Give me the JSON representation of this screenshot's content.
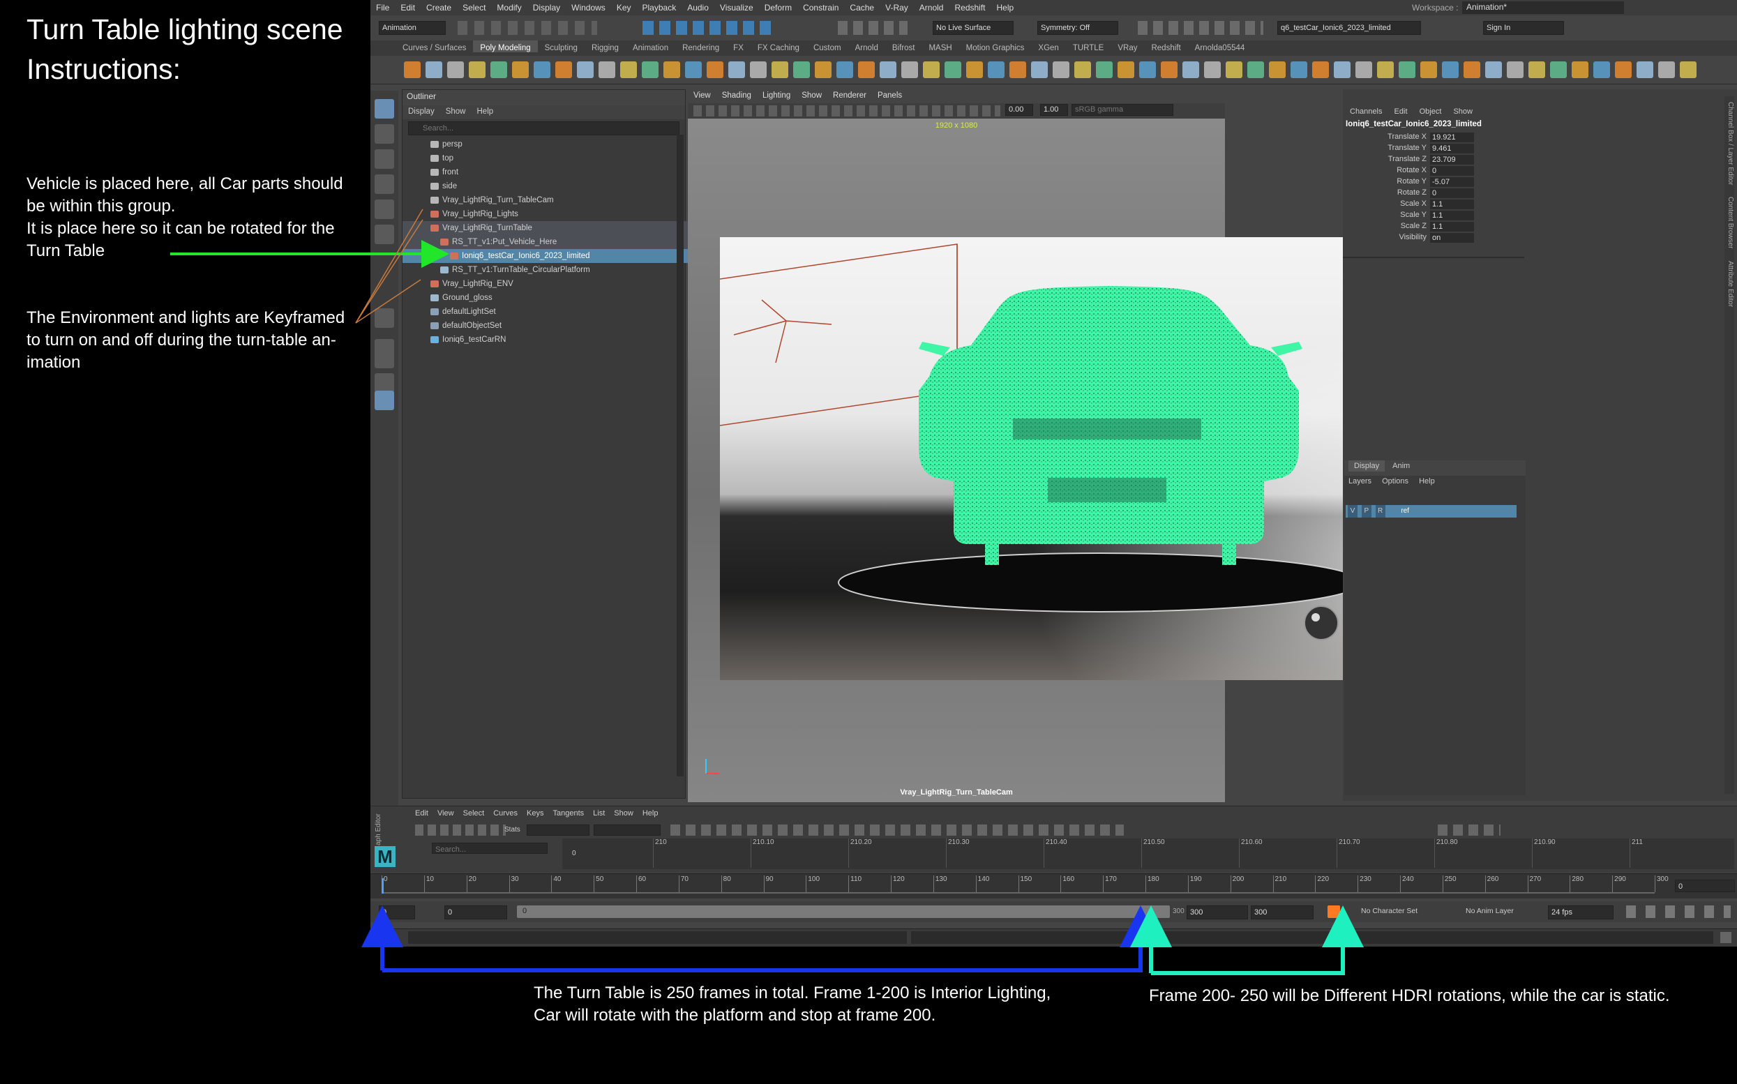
{
  "annotations": {
    "title_line1": "Turn Table lighting scene",
    "title_line2": "Instructions:",
    "vehicle_note_1": "Vehicle is placed here, all Car parts should",
    "vehicle_note_2": "be within this group.",
    "vehicle_note_3": "It is place here so it can be rotated for the",
    "vehicle_note_4": "Turn Table",
    "env_note_1": "The Environment and lights are Keyframed",
    "env_note_2": "to turn on and off during the turn-table an-",
    "env_note_3": "imation",
    "frames_note_1": "The Turn Table is 250 frames in total.  Frame 1-200 is Interior Lighting,",
    "frames_note_2": "Car will rotate with the platform and stop at frame 200.",
    "hdri_note": "Frame 200- 250 will be Different HDRI rotations, while the car is static."
  },
  "menubar": [
    "File",
    "Edit",
    "Create",
    "Select",
    "Modify",
    "Display",
    "Windows",
    "Key",
    "Playback",
    "Audio",
    "Visualize",
    "Deform",
    "Constrain",
    "Cache",
    "V-Ray",
    "Arnold",
    "Redshift",
    "Help"
  ],
  "status": {
    "mode": "Animation",
    "live_surface": "No Live Surface",
    "symmetry": "Symmetry: Off",
    "scene_name": "q6_testCar_Ionic6_2023_limited",
    "sign_in": "Sign In",
    "workspace_label": "Workspace :",
    "workspace": "Animation*"
  },
  "shelf_tabs": [
    "Curves / Surfaces",
    "Poly Modeling",
    "Sculpting",
    "Rigging",
    "Animation",
    "Rendering",
    "FX",
    "FX Caching",
    "Custom",
    "Arnold",
    "Bifrost",
    "MASH",
    "Motion Graphics",
    "XGen",
    "TURTLE",
    "VRay",
    "Redshift",
    "Arnolda05544"
  ],
  "shelf_active": "Poly Modeling",
  "outliner": {
    "title": "Outliner",
    "menu": [
      "Display",
      "Show",
      "Help"
    ],
    "search_placeholder": "Search...",
    "items": [
      {
        "label": "persp",
        "indent": 0,
        "type": "camera",
        "state": ""
      },
      {
        "label": "top",
        "indent": 0,
        "type": "camera",
        "state": ""
      },
      {
        "label": "front",
        "indent": 0,
        "type": "camera",
        "state": ""
      },
      {
        "label": "side",
        "indent": 0,
        "type": "camera",
        "state": ""
      },
      {
        "label": "Vray_LightRig_Turn_TableCam",
        "indent": 0,
        "type": "camera",
        "state": ""
      },
      {
        "label": "Vray_LightRig_Lights",
        "indent": 0,
        "type": "group",
        "state": ""
      },
      {
        "label": "Vray_LightRig_TurnTable",
        "indent": 0,
        "type": "group",
        "state": "group"
      },
      {
        "label": "RS_TT_v1:Put_Vehicle_Here",
        "indent": 1,
        "type": "group",
        "state": "group"
      },
      {
        "label": "Ioniq6_testCar_Ionic6_2023_limited",
        "indent": 2,
        "type": "group",
        "state": "selected"
      },
      {
        "label": "RS_TT_v1:TurnTable_CircularPlatform",
        "indent": 1,
        "type": "mesh",
        "state": ""
      },
      {
        "label": "Vray_LightRig_ENV",
        "indent": 0,
        "type": "group",
        "state": ""
      },
      {
        "label": "Ground_gloss",
        "indent": 0,
        "type": "mesh",
        "state": ""
      },
      {
        "label": "defaultLightSet",
        "indent": 0,
        "type": "set",
        "state": ""
      },
      {
        "label": "defaultObjectSet",
        "indent": 0,
        "type": "set",
        "state": ""
      },
      {
        "label": "Ioniq6_testCarRN",
        "indent": 0,
        "type": "ref",
        "state": ""
      }
    ]
  },
  "viewport": {
    "menu": [
      "View",
      "Shading",
      "Lighting",
      "Show",
      "Renderer",
      "Panels"
    ],
    "exposure": "0.00",
    "gamma": "1.00",
    "color_space": "sRGB gamma",
    "resolution": "1920 x 1080",
    "camera": "Vray_LightRig_Turn_TableCam"
  },
  "channel_box": {
    "tabs": [
      "Channels",
      "Edit",
      "Object",
      "Show"
    ],
    "object": "Ioniq6_testCar_Ionic6_2023_limited",
    "attrs": [
      {
        "name": "Translate X",
        "value": "19.921"
      },
      {
        "name": "Translate Y",
        "value": "9.461"
      },
      {
        "name": "Translate Z",
        "value": "23.709"
      },
      {
        "name": "Rotate X",
        "value": "0"
      },
      {
        "name": "Rotate Y",
        "value": "-5.07"
      },
      {
        "name": "Rotate Z",
        "value": "0"
      },
      {
        "name": "Scale X",
        "value": "1.1"
      },
      {
        "name": "Scale Y",
        "value": "1.1"
      },
      {
        "name": "Scale Z",
        "value": "1.1"
      },
      {
        "name": "Visibility",
        "value": "on"
      }
    ],
    "side_tabs": [
      "Channel Box / Layer Editor",
      "Content Browser",
      "Attribute Editor"
    ],
    "layer_tabs": [
      "Display",
      "Anim"
    ],
    "layer_menu": [
      "Layers",
      "Options",
      "Help"
    ],
    "layer": {
      "v": "V",
      "p": "P",
      "r": "R",
      "name": "ref"
    }
  },
  "graph_editor": {
    "label": "aph Editor",
    "menu": [
      "Edit",
      "View",
      "Select",
      "Curves",
      "Keys",
      "Tangents",
      "List",
      "Show",
      "Help"
    ],
    "stats": "Stats",
    "search_placeholder": "Search...",
    "ticks": [
      "210",
      "210.10",
      "210.20",
      "210.30",
      "210.40",
      "210.50",
      "210.60",
      "210.70",
      "210.80",
      "210.90",
      "211"
    ],
    "zero": "0"
  },
  "time_slider": {
    "ticks": [
      "0",
      "10",
      "20",
      "30",
      "40",
      "50",
      "60",
      "70",
      "80",
      "90",
      "100",
      "110",
      "120",
      "130",
      "140",
      "150",
      "160",
      "170",
      "180",
      "190",
      "200",
      "210",
      "220",
      "230",
      "240",
      "250",
      "260",
      "270",
      "280",
      "290",
      "300"
    ],
    "current_frame": "0"
  },
  "range": {
    "start": "0",
    "playback_start": "0",
    "range_label": "0",
    "range_end_label": "300",
    "playback_end": "300",
    "end": "300",
    "character_set": "No Character Set",
    "anim_layer": "No Anim Layer",
    "fps": "24 fps"
  },
  "command_line": {
    "label": "ython"
  },
  "colors": {
    "selection": "#5285a6",
    "car_wireframe": "#3ff5a6",
    "arrow_green": "#22e62a",
    "arrow_blue": "#1a35f0",
    "arrow_cyan": "#1ff0c0",
    "light_wire": "#b0462e"
  }
}
